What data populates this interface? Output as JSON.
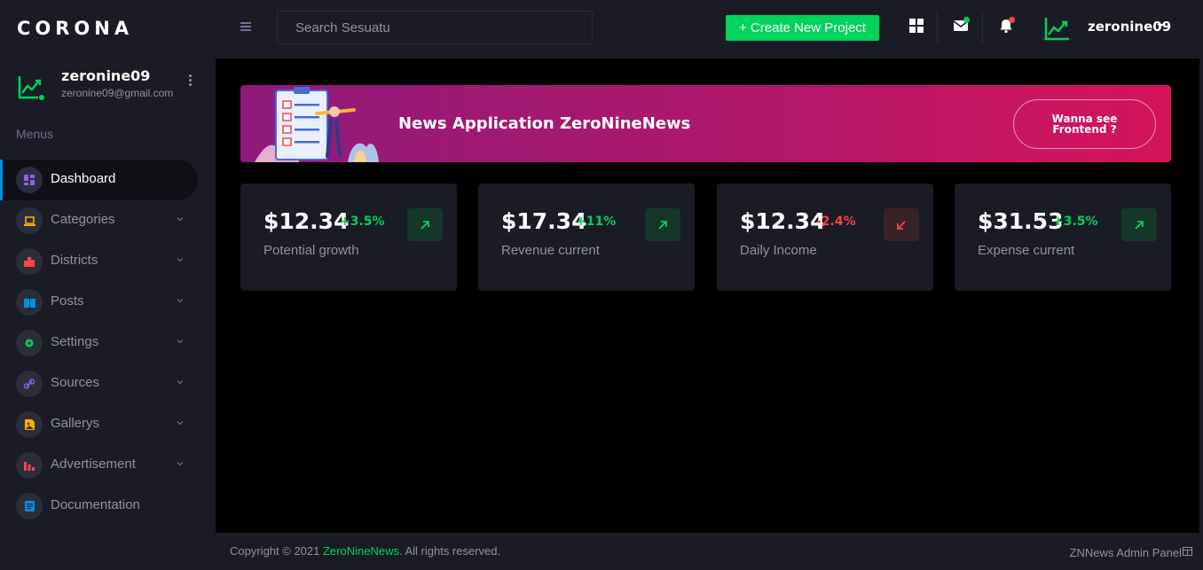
{
  "brand": "CORONA",
  "profile": {
    "name": "zeronine09",
    "email": "zeronine09@gmail.com",
    "avatar_icon": "trending-up-icon",
    "status_color": "#00d25b"
  },
  "sidebar": {
    "section_label": "Menus",
    "items": [
      {
        "label": "Dashboard",
        "icon": "dashboard-icon",
        "color": "#8f5fe8",
        "active": true,
        "has_chevron": false
      },
      {
        "label": "Categories",
        "icon": "laptop-icon",
        "color": "#ffab00",
        "has_chevron": true
      },
      {
        "label": "Districts",
        "icon": "buildings-icon",
        "color": "#fc424a",
        "has_chevron": true
      },
      {
        "label": "Posts",
        "icon": "book-icon",
        "color": "#0090e7",
        "has_chevron": true
      },
      {
        "label": "Settings",
        "icon": "gear-icon",
        "color": "#00d25b",
        "has_chevron": true
      },
      {
        "label": "Sources",
        "icon": "link-icon",
        "color": "#8f5fe8",
        "has_chevron": true
      },
      {
        "label": "Gallerys",
        "icon": "image-icon",
        "color": "#ffab00",
        "has_chevron": true
      },
      {
        "label": "Advertisement",
        "icon": "bar-chart-icon",
        "color": "#fc424a",
        "has_chevron": true
      },
      {
        "label": "Documentation",
        "icon": "document-icon",
        "color": "#0090e7",
        "has_chevron": false
      }
    ]
  },
  "topbar": {
    "search_placeholder": "Search Sesuatu",
    "create_label": "+ Create New Project",
    "user_name": "zeronine09"
  },
  "banner": {
    "title": "News Application ZeroNineNews",
    "button_label": "Wanna see Frontend ?"
  },
  "cards": [
    {
      "value": "$12.34",
      "change": "+3.5%",
      "label": "Potential growth",
      "trend": "up"
    },
    {
      "value": "$17.34",
      "change": "+11%",
      "label": "Revenue current",
      "trend": "up"
    },
    {
      "value": "$12.34",
      "change": "-2.4%",
      "label": "Daily Income",
      "trend": "down"
    },
    {
      "value": "$31.53",
      "change": "+3.5%",
      "label": "Expense current",
      "trend": "up"
    }
  ],
  "footer": {
    "copyright_prefix": "Copyright © 2021 ",
    "copyright_brand": "ZeroNineNews",
    "copyright_suffix": ". All rights reserved.",
    "right_text": "ZNNews Admin Panel"
  },
  "colors": {
    "success": "#00d25b",
    "danger": "#fc424a",
    "primary": "#0090e7",
    "sidebar_bg": "#191c24"
  }
}
